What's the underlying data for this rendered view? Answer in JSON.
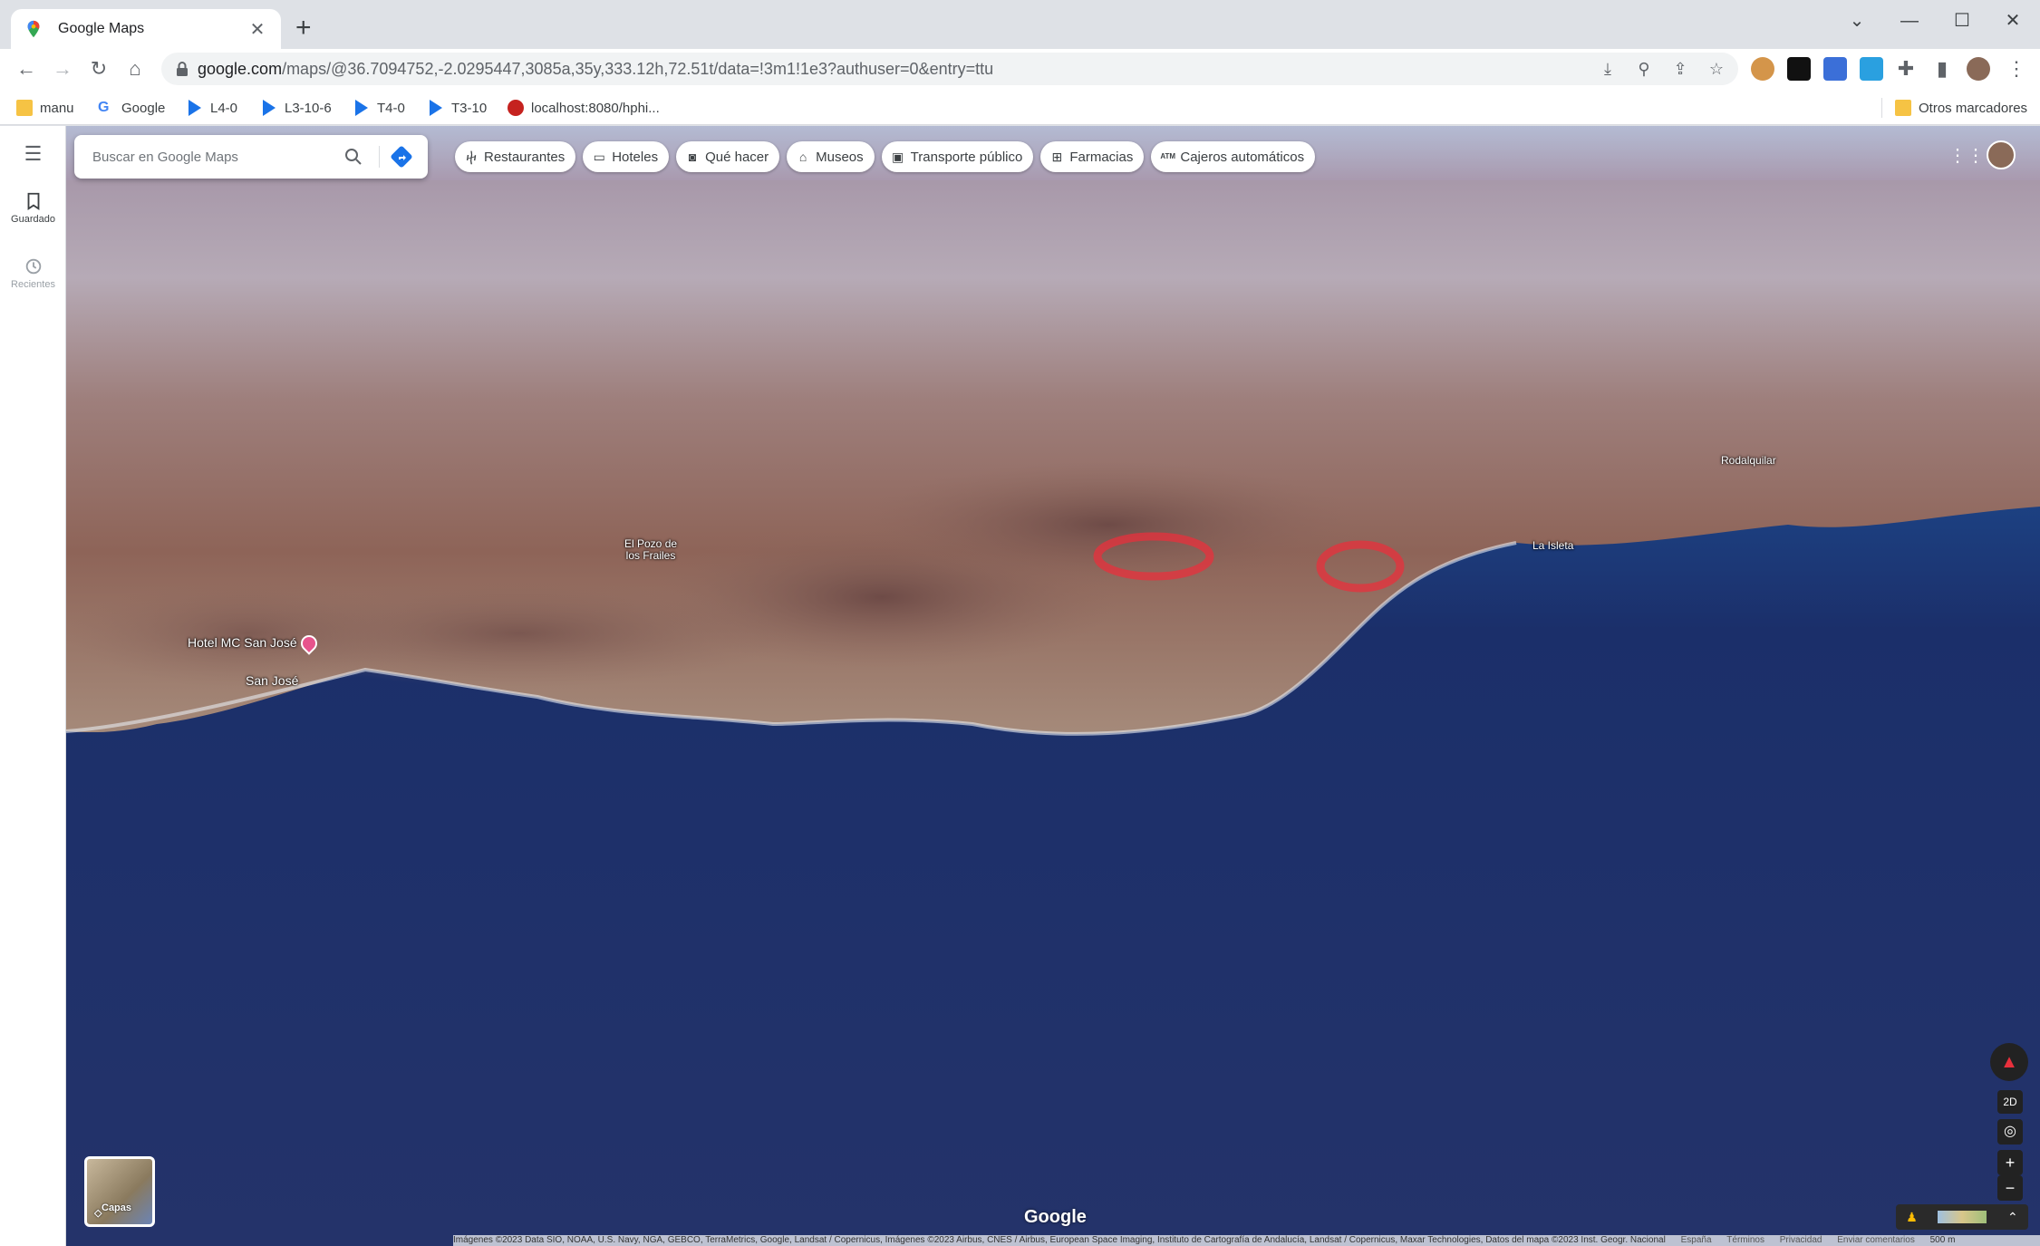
{
  "browser": {
    "tab_title": "Google Maps",
    "url_domain": "google.com",
    "url_path": "/maps/@36.7094752,-2.0295447,3085a,35y,333.12h,72.51t/data=!3m1!1e3?authuser=0&entry=ttu",
    "bookmarks": [
      {
        "label": "manu",
        "icon": "folder-icon"
      },
      {
        "label": "Google",
        "icon": "google-icon"
      },
      {
        "label": "L4-0",
        "icon": "play-icon"
      },
      {
        "label": "L3-10-6",
        "icon": "play-icon"
      },
      {
        "label": "T4-0",
        "icon": "play-icon"
      },
      {
        "label": "T3-10",
        "icon": "play-icon"
      },
      {
        "label": "localhost:8080/hphi...",
        "icon": "site-icon"
      }
    ],
    "other_bookmarks": "Otros marcadores"
  },
  "sidebar": {
    "saved_label": "Guardado",
    "recent_label": "Recientes"
  },
  "search": {
    "placeholder": "Buscar en Google Maps"
  },
  "chips": [
    {
      "label": "Restaurantes",
      "icon": "fork-knife-icon"
    },
    {
      "label": "Hoteles",
      "icon": "bed-icon"
    },
    {
      "label": "Qué hacer",
      "icon": "camera-icon"
    },
    {
      "label": "Museos",
      "icon": "museum-icon"
    },
    {
      "label": "Transporte público",
      "icon": "transit-icon"
    },
    {
      "label": "Farmacias",
      "icon": "pharmacy-icon"
    },
    {
      "label": "Cajeros automáticos",
      "icon": "atm-icon"
    }
  ],
  "map_labels": {
    "pozo_line1": "El Pozo de",
    "pozo_line2": "los Frailes",
    "hotel": "Hotel MC San José",
    "san_jose": "San José",
    "isleta": "La Isleta",
    "rodalquilar": "Rodalquilar"
  },
  "controls": {
    "view_2d": "2D",
    "layers_label": "Capas"
  },
  "footer": {
    "google": "Google",
    "attribution": "Imágenes ©2023 Data SIO, NOAA, U.S. Navy, NGA, GEBCO, TerraMetrics, Google, Landsat / Copernicus, Imágenes ©2023 Airbus, CNES / Airbus, European Space Imaging, Instituto de Cartografía de Andalucía, Landsat / Copernicus, Maxar Technologies, Datos del mapa ©2023 Inst. Geogr. Nacional",
    "links": [
      "España",
      "Términos",
      "Privacidad",
      "Enviar comentarios"
    ],
    "scale": "500 m"
  },
  "colors": {
    "sea": "#1e4f95",
    "deep_sea": "#1a2a60",
    "land": "#8f6a60",
    "annotation": "#e8303c"
  }
}
